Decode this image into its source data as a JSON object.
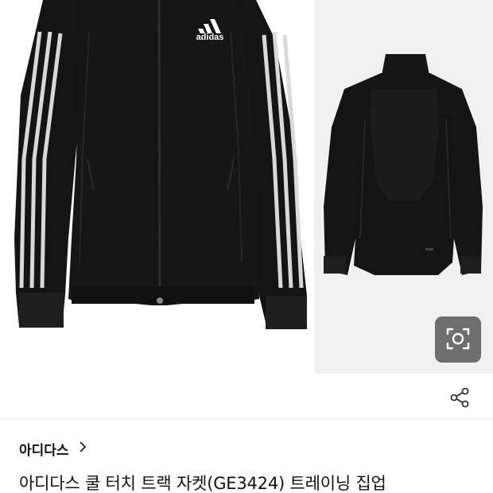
{
  "product": {
    "brand_logo_text": "adidas",
    "brand_name": "아디다스",
    "title": "아디다스 쿨 터치 트랙 자켓(GE3424) 트레이닝 집업"
  },
  "icons": {
    "lens": "camera-search-icon",
    "share": "share-icon",
    "brand_chevron": "chevron-right-icon"
  },
  "colors": {
    "jacket": "#141414",
    "stripe": "#d9d9d9",
    "lens_button": "#6e6e6e",
    "side_bg": "#f0f0f0"
  }
}
